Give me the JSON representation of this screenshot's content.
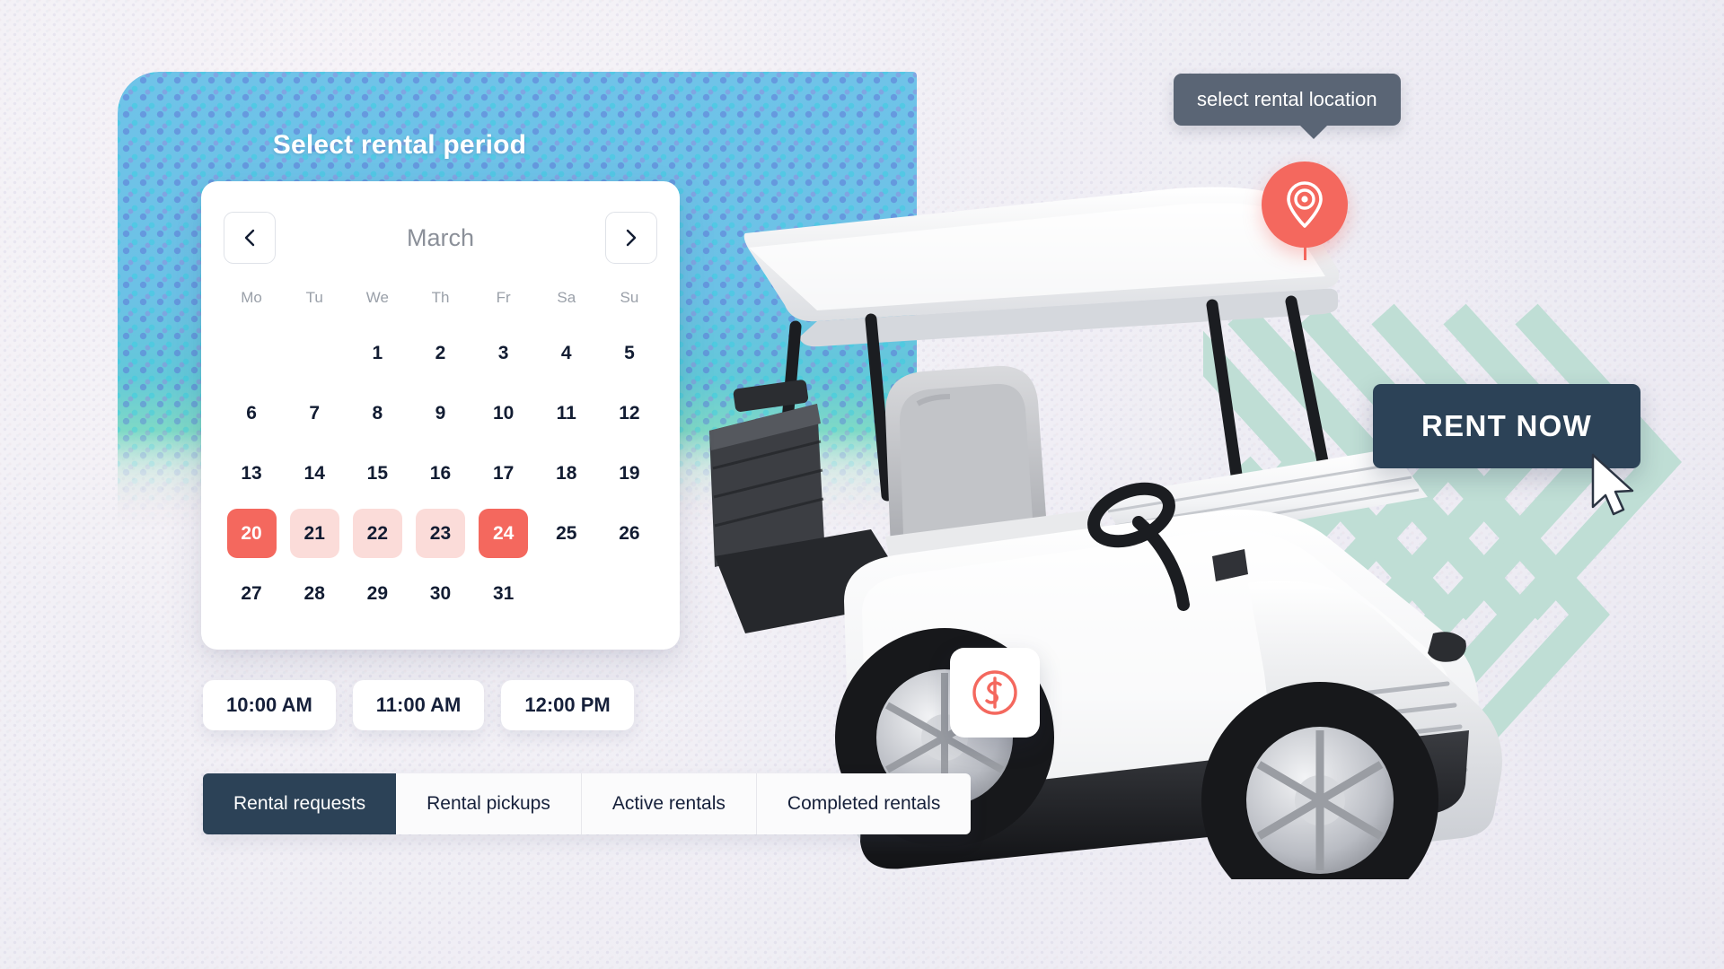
{
  "banner": {
    "title": "Select rental period"
  },
  "calendar": {
    "month": "March",
    "prev_icon": "chevron-left-icon",
    "next_icon": "chevron-right-icon",
    "weekdays": [
      "Mo",
      "Tu",
      "We",
      "Th",
      "Fr",
      "Sa",
      "Su"
    ],
    "leading_blanks": 2,
    "days": [
      1,
      2,
      3,
      4,
      5,
      6,
      7,
      8,
      9,
      10,
      11,
      12,
      13,
      14,
      15,
      16,
      17,
      18,
      19,
      20,
      21,
      22,
      23,
      24,
      25,
      26,
      27,
      28,
      29,
      30,
      31
    ],
    "selection": {
      "start": 20,
      "end": 24,
      "in_range": [
        21,
        22,
        23
      ],
      "edge_color": "#f4685e",
      "range_color": "#fbdcd9"
    }
  },
  "time_slots": [
    {
      "label": "10:00 AM"
    },
    {
      "label": "11:00 AM"
    },
    {
      "label": "12:00 PM"
    }
  ],
  "tabs": [
    {
      "label": "Rental requests",
      "active": true
    },
    {
      "label": "Rental pickups",
      "active": false
    },
    {
      "label": "Active rentals",
      "active": false
    },
    {
      "label": "Completed rentals",
      "active": false
    }
  ],
  "tooltip": {
    "text": "select rental location",
    "background": "#5a6575"
  },
  "pin": {
    "icon": "map-pin-icon",
    "color": "#f4685e"
  },
  "price_badge": {
    "icon": "dollar-circle-icon",
    "color": "#f4685e"
  },
  "cta": {
    "label": "RENT NOW",
    "background": "#2c4257",
    "cursor_icon": "mouse-pointer-icon"
  },
  "decor": {
    "chevron_color": "#bfded5",
    "vehicle": "golf-cart-illustration"
  }
}
